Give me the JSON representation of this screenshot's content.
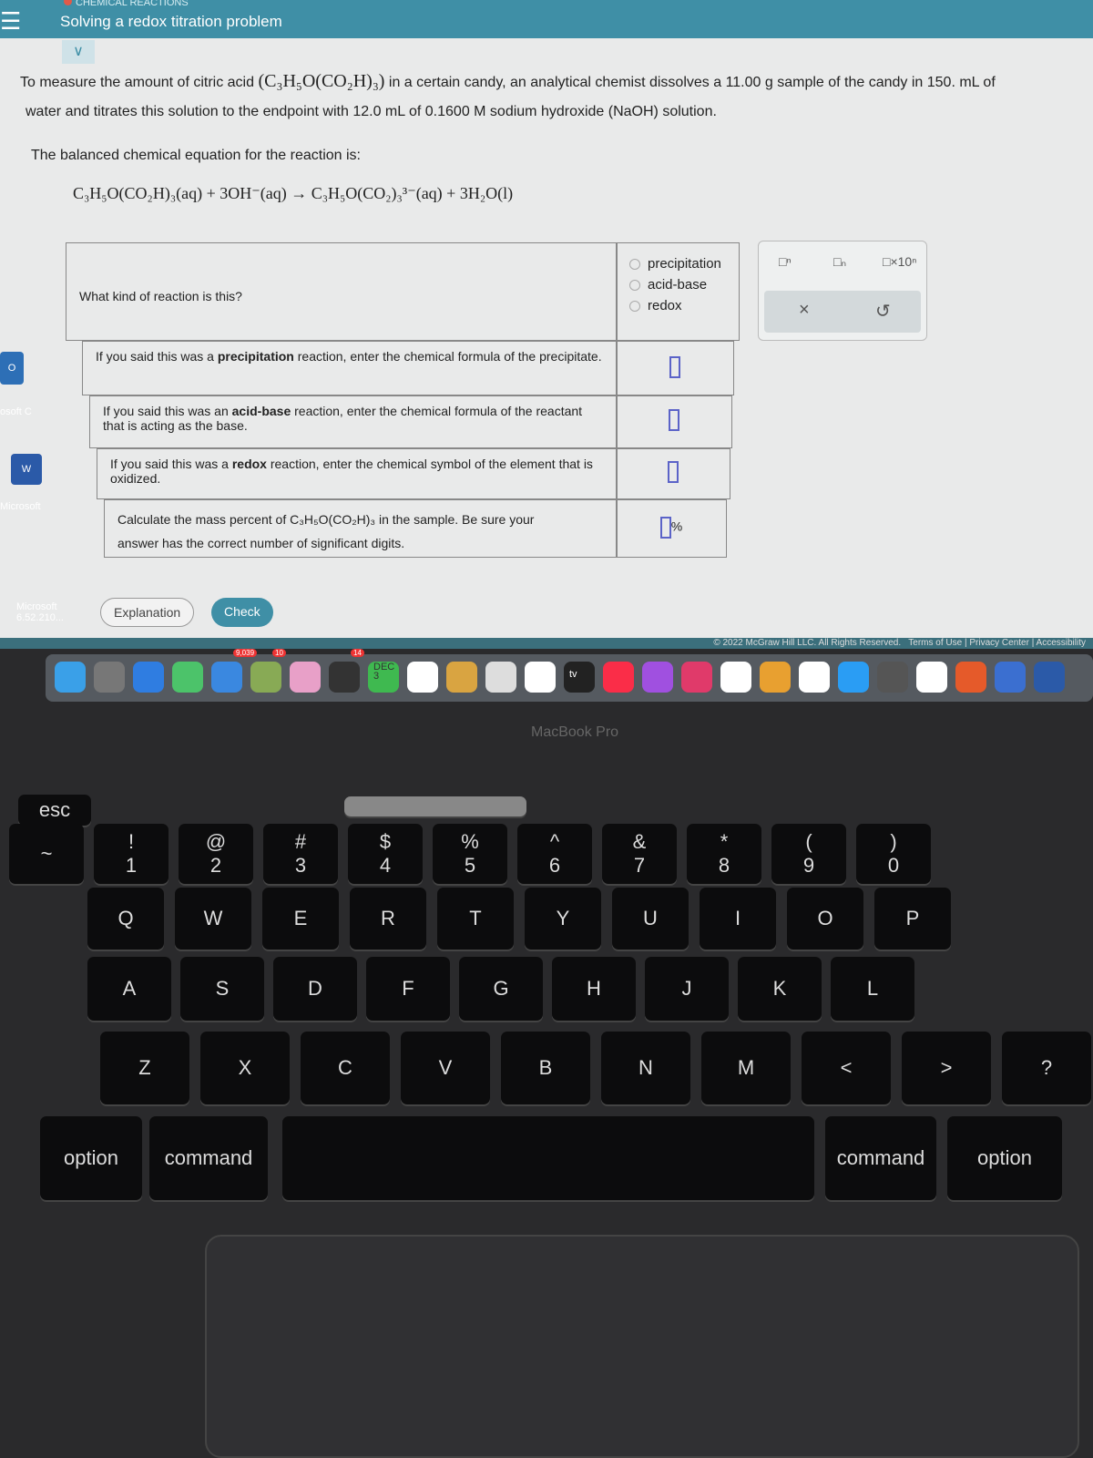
{
  "header": {
    "category": "CHEMICAL REACTIONS",
    "title": "Solving a redox titration problem",
    "menu_icon": "hamburger-icon"
  },
  "problem": {
    "line1a": "To measure the amount of citric acid",
    "formula": "(C₃H₅O(CO₂H)₃)",
    "line1b": "in a certain candy, an analytical chemist dissolves a 11.00 g sample of the candy in 150. mL of",
    "line2": "water and titrates this solution to the endpoint with 12.0 mL of 0.1600 M sodium hydroxide (NaOH) solution.",
    "line3": "The balanced chemical equation for the reaction is:",
    "equation": "C₃H₅O(CO₂H)₃(aq) + 3OH⁻(aq) → C₃H₅O(CO₂)₃³⁻(aq) + 3H₂O(l)"
  },
  "table": {
    "q1": "What kind of reaction is this?",
    "options": [
      "precipitation",
      "acid-base",
      "redox"
    ],
    "q2a": "If you said this was a ",
    "q2b": "precipitation",
    "q2c": " reaction, enter the chemical formula of the precipitate.",
    "q3a": "If you said this was an ",
    "q3b": "acid-base",
    "q3c": " reaction, enter the chemical formula of the reactant that is acting as the base.",
    "q4a": "If you said this was a ",
    "q4b": "redox",
    "q4c": " reaction, enter the chemical symbol of the element that is oxidized.",
    "q5a": "Calculate the mass percent of C₃H₅O(CO₂H)₃ in the sample. Be sure your",
    "q5b": "answer has the correct number of significant digits.",
    "percent": "%"
  },
  "palette": {
    "sup": "□ⁿ",
    "sub": "□ₙ",
    "sci": "□×10ⁿ",
    "clear": "×",
    "undo": "↺"
  },
  "buttons": {
    "explanation": "Explanation",
    "check": "Check"
  },
  "footer": {
    "copyright": "© 2022 McGraw Hill LLC. All Rights Reserved.",
    "terms": "Terms of Use",
    "privacy": "Privacy Center",
    "accessibility": "Accessibility"
  },
  "desktop": {
    "item1": "osoft C",
    "item2": "Microsoft",
    "item3": "Microsoft 6.52.210..."
  },
  "dock": {
    "badge1": "10",
    "badge2": "9,039",
    "badge3": "14",
    "cal_month": "DEC",
    "cal_day": "3",
    "tv": "tv"
  },
  "laptop": {
    "brand": "MacBook Pro"
  },
  "keyboard": {
    "row0": [
      "esc"
    ],
    "row1": [
      "~",
      "!\n1",
      "@\n2",
      "#\n3",
      "$\n4",
      "%\n5",
      "^\n6",
      "&\n7",
      "*\n8",
      "(\n9",
      ")\n0"
    ],
    "row2": [
      "Q",
      "W",
      "E",
      "R",
      "T",
      "Y",
      "U",
      "I",
      "O",
      "P"
    ],
    "row3": [
      "A",
      "S",
      "D",
      "F",
      "G",
      "H",
      "J",
      "K",
      "L"
    ],
    "row4": [
      "Z",
      "X",
      "C",
      "V",
      "B",
      "N",
      "M",
      "<",
      ">",
      "?"
    ],
    "row5": [
      "option",
      "command",
      "",
      "command",
      "option"
    ]
  }
}
